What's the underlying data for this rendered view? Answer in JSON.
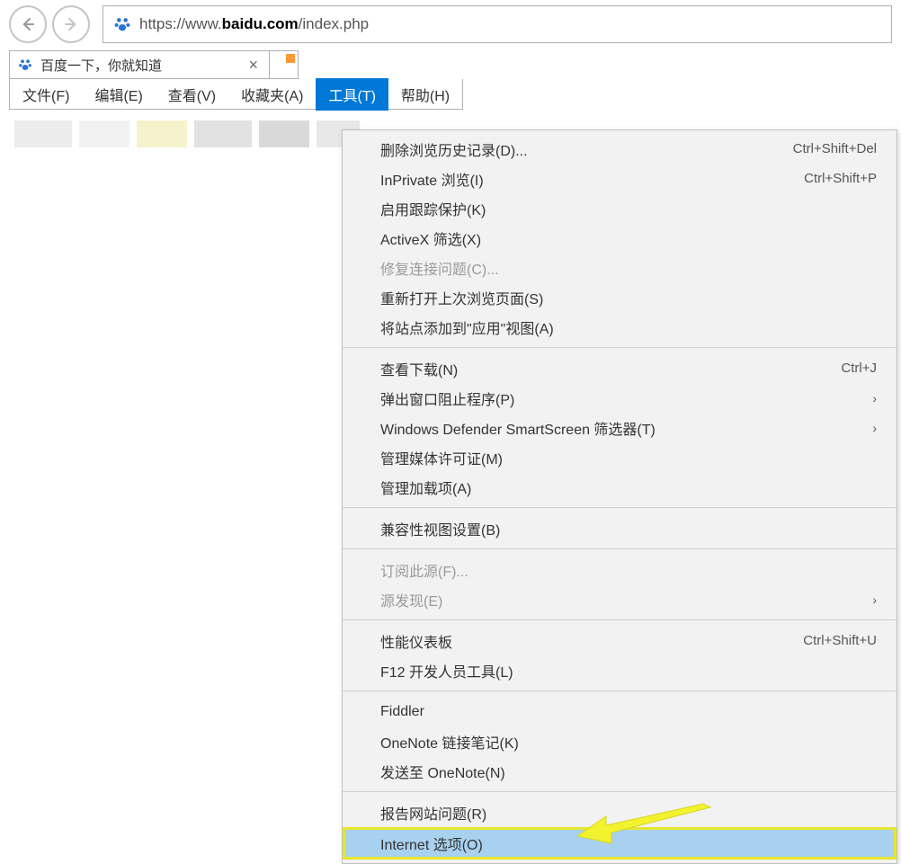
{
  "url": {
    "prefix": "https://www.",
    "domain": "baidu.com",
    "path": "/index.php"
  },
  "tab": {
    "title": "百度一下，你就知道"
  },
  "menubar": {
    "file": "文件(F)",
    "edit": "编辑(E)",
    "view": "查看(V)",
    "favorites": "收藏夹(A)",
    "tools": "工具(T)",
    "help": "帮助(H)"
  },
  "dropdown": {
    "g1": [
      {
        "label": "删除浏览历史记录(D)...",
        "shortcut": "Ctrl+Shift+Del"
      },
      {
        "label": "InPrivate 浏览(I)",
        "shortcut": "Ctrl+Shift+P"
      },
      {
        "label": "启用跟踪保护(K)",
        "shortcut": ""
      },
      {
        "label": "ActiveX 筛选(X)",
        "shortcut": ""
      },
      {
        "label": "修复连接问题(C)...",
        "shortcut": "",
        "disabled": true
      },
      {
        "label": "重新打开上次浏览页面(S)",
        "shortcut": ""
      },
      {
        "label": "将站点添加到\"应用\"视图(A)",
        "shortcut": ""
      }
    ],
    "g2": [
      {
        "label": "查看下载(N)",
        "shortcut": "Ctrl+J"
      },
      {
        "label": "弹出窗口阻止程序(P)",
        "submenu": true
      },
      {
        "label": "Windows Defender SmartScreen 筛选器(T)",
        "submenu": true
      },
      {
        "label": "管理媒体许可证(M)",
        "shortcut": ""
      },
      {
        "label": "管理加载项(A)",
        "shortcut": ""
      }
    ],
    "g3": [
      {
        "label": "兼容性视图设置(B)",
        "shortcut": ""
      }
    ],
    "g4": [
      {
        "label": "订阅此源(F)...",
        "shortcut": "",
        "disabled": true
      },
      {
        "label": "源发现(E)",
        "submenu": true,
        "disabled": true
      }
    ],
    "g5": [
      {
        "label": "性能仪表板",
        "shortcut": "Ctrl+Shift+U"
      },
      {
        "label": "F12 开发人员工具(L)",
        "shortcut": ""
      }
    ],
    "g6": [
      {
        "label": "Fiddler",
        "shortcut": ""
      },
      {
        "label": "OneNote 链接笔记(K)",
        "shortcut": ""
      },
      {
        "label": "发送至 OneNote(N)",
        "shortcut": ""
      }
    ],
    "g7": [
      {
        "label": "报告网站问题(R)",
        "shortcut": ""
      },
      {
        "label": "Internet 选项(O)",
        "shortcut": "",
        "highlighted": true
      }
    ]
  }
}
